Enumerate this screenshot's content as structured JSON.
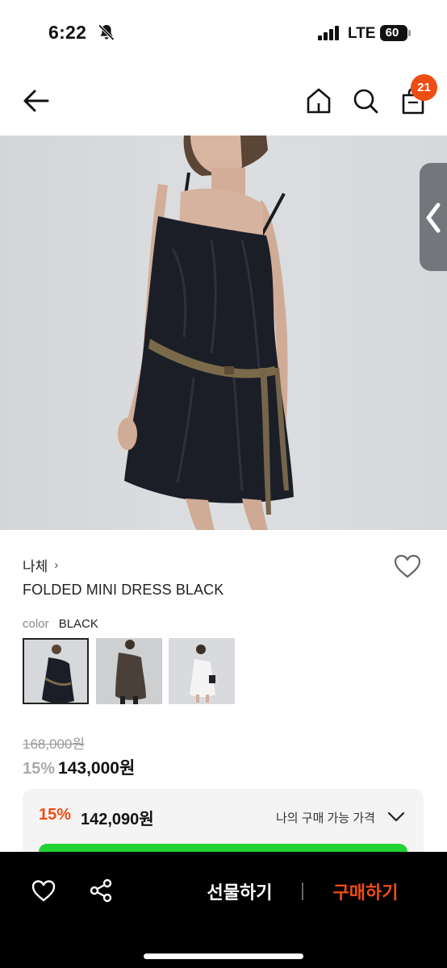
{
  "status": {
    "time": "6:22",
    "network": "LTE",
    "battery": "60"
  },
  "nav": {
    "cart_count": "21"
  },
  "product": {
    "brand": "나체",
    "brand_chevron": "›",
    "title": "FOLDED MINI DRESS BLACK",
    "color_label": "color",
    "color_value": "BLACK",
    "original_price": "168,000원",
    "discount": "15%",
    "price": "143,000원",
    "thumbnails": [
      {
        "name": "black",
        "selected": true
      },
      {
        "name": "brown",
        "selected": false
      },
      {
        "name": "white",
        "selected": false
      }
    ]
  },
  "benefit": {
    "discount": "15%",
    "price": "142,090원",
    "label": "나의 구매 가능 가격"
  },
  "bottom": {
    "gift_label": "선물하기",
    "buy_label": "구매하기"
  },
  "colors": {
    "accent": "#ef4d14",
    "green": "#22d233",
    "bottom_bar": "#000000"
  }
}
